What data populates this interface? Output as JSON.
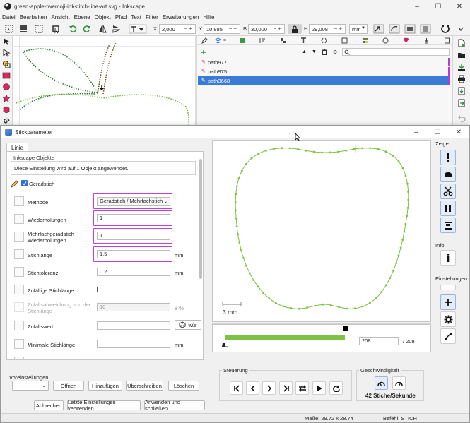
{
  "inkscape": {
    "title": "green-apple-twemoji-inkstitch-line-art.svg - Inkscape",
    "window_controls": [
      "–",
      "☐",
      "✕"
    ],
    "menu": [
      "Datei",
      "Bearbeiten",
      "Ansicht",
      "Ebene",
      "Objekt",
      "Pfad",
      "Text",
      "Filter",
      "Erweiterungen",
      "Hilfe"
    ],
    "toolbar": {
      "x_label": "X:",
      "x_value": "2,000",
      "y_label": "Y:",
      "y_value": "10,885",
      "w_label": "B:",
      "w_value": "30,000",
      "h_label": "H:",
      "h_value": "29,008",
      "unit": "mm"
    },
    "objects": [
      {
        "label": "path977",
        "selected": false
      },
      {
        "label": "path975",
        "selected": false
      },
      {
        "label": "path3668",
        "selected": true
      }
    ]
  },
  "dialog": {
    "title": "Stickparameter",
    "tab": "Linie",
    "group_title": "Inkscape Objekte",
    "group_text": "Diese Einstellung wird auf 1 Objekt angewendet.",
    "stitch_type": "Geradstich",
    "params": [
      {
        "label": "Methode",
        "value": "Geradstich / Mehrfachstich",
        "unit": "",
        "kind": "select",
        "highlight": true,
        "enabled": true
      },
      {
        "label": "Wiederholungen",
        "value": "1",
        "unit": "",
        "kind": "input",
        "highlight": true,
        "enabled": true
      },
      {
        "label": "Mehrfachgeradstich Wiederholungen",
        "value": "1",
        "unit": "",
        "kind": "input",
        "highlight": true,
        "enabled": true
      },
      {
        "label": "Stichlänge",
        "value": "1.5",
        "unit": "mm",
        "kind": "input",
        "highlight": true,
        "enabled": true
      },
      {
        "label": "Stichtoleranz",
        "value": "0.2",
        "unit": "mm",
        "kind": "input",
        "highlight": false,
        "enabled": true
      },
      {
        "label": "Zufällige Stichlänge",
        "value": "",
        "unit": "",
        "kind": "checkbox",
        "highlight": false,
        "enabled": true
      },
      {
        "label": "Zufallsabweichung von der Stichlänge",
        "value": "10",
        "unit": "± %",
        "kind": "input",
        "highlight": false,
        "enabled": false
      },
      {
        "label": "Zufallswert",
        "value": "",
        "unit": "wür",
        "kind": "input",
        "highlight": false,
        "enabled": true
      },
      {
        "label": "Minimale Stichlänge",
        "value": "",
        "unit": "mm",
        "kind": "input",
        "highlight": false,
        "enabled": true
      }
    ],
    "presets": {
      "label": "Voreinstellungen",
      "open": "Öffnen",
      "add": "Hinzufügen",
      "overwrite": "Überschreiben",
      "delete": "Löschen"
    },
    "footer": {
      "cancel": "Abbrechen",
      "use_last": "Letzte Einstellungen verwenden",
      "apply_close": "Anwenden und schließen"
    },
    "preview": {
      "scale_label": "3 mm",
      "stitch_current": "208",
      "stitch_total": "/ 208",
      "progress": 1.0,
      "steuerung": "Steuerung",
      "geschwindigkeit": "Geschwindigkeit",
      "speed_text": "42 Stiche/Sekunde",
      "status_size": "Maße: 29.72 x 28.74",
      "status_cmd": "Befehl: STICH"
    },
    "side": {
      "show": "Zeige",
      "info": "Info",
      "settings": "Einstellungen"
    },
    "colors": {
      "stitch": "#7dc242",
      "highlight": "#c13fe0",
      "selection": "#3a7bd5"
    }
  }
}
